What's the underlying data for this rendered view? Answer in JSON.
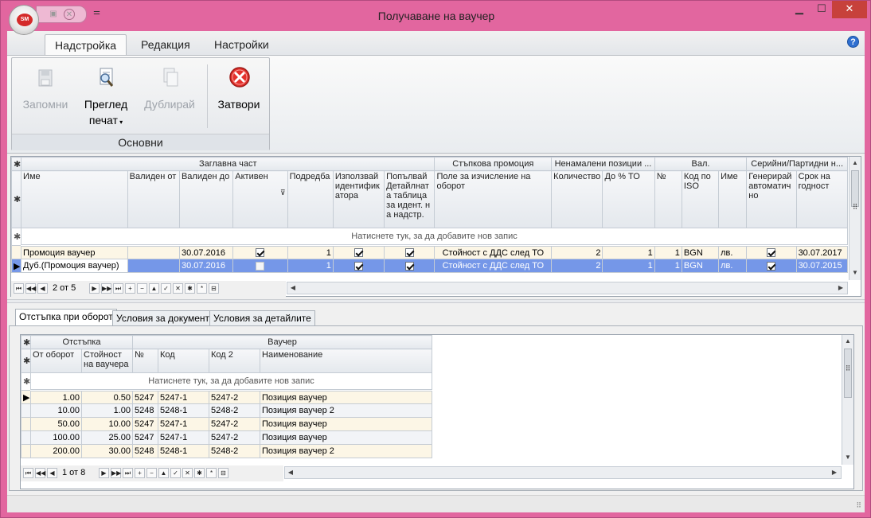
{
  "window": {
    "title": "Получаване на ваучер",
    "orb_text": "SM",
    "min": "▁",
    "max": "☐",
    "close": "✕",
    "help": "?"
  },
  "ribbon": {
    "tabs": [
      "Надстройка",
      "Редакция",
      "Настройки"
    ],
    "group_label": "Основни",
    "buttons": {
      "save": "Запомни",
      "preview_l1": "Преглед",
      "preview_l2": "печат",
      "duplicate": "Дублирай",
      "close": "Затвори"
    }
  },
  "grid1": {
    "bands": {
      "header": "Заглавна част",
      "step": "Стъпкова промоция",
      "nondisc": "Ненамалени позиции ...",
      "currency": "Вал.",
      "serial": "Серийни/Партидни н..."
    },
    "columns": [
      "Име",
      "Валиден от",
      "Валиден до",
      "Активен",
      "Подредба",
      "Използвай идентификатора",
      "Попълвай Детайлната таблица за идент. на надстр.",
      "Поле за изчисление на оборот",
      "Количество",
      "До % ТО",
      "№",
      "Код по ISO",
      "Име",
      "Генерирай автоматично",
      "Срок на годност"
    ],
    "new_row": "Натиснете тук, за да добавите нов запис",
    "rows": [
      {
        "name": "Промоция ваучер",
        "from": "",
        "to": "30.07.2016",
        "active": true,
        "order": "1",
        "use_id": true,
        "fill": true,
        "field": "Стойност с ДДС след ТО",
        "qty": "2",
        "pct": "1",
        "no": "1",
        "iso": "BGN",
        "cname": "лв.",
        "gen": true,
        "expiry": "30.07.2017"
      },
      {
        "name": "Дуб.(Промоция ваучер)",
        "from": "",
        "to": "30.07.2016",
        "active": false,
        "order": "1",
        "use_id": true,
        "fill": true,
        "field": "Стойност с ДДС след ТО",
        "qty": "2",
        "pct": "1",
        "no": "1",
        "iso": "BGN",
        "cname": "лв.",
        "gen": true,
        "expiry": "30.07.2015"
      }
    ],
    "nav": {
      "position": "2 от 5"
    }
  },
  "detail_tabs": [
    "Отстъпка при оборот",
    "Условия за документа",
    "Условия за детайлите"
  ],
  "grid2": {
    "bands": {
      "discount": "Отстъпка",
      "voucher": "Ваучер"
    },
    "columns": [
      "От оборот",
      "Стойност на ваучера",
      "№",
      "Код",
      "Код 2",
      "Наименование"
    ],
    "new_row": "Натиснете тук, за да добавите нов запис",
    "rows": [
      {
        "from": "1.00",
        "value": "0.50",
        "no": "5247",
        "code": "5247-1",
        "code2": "5247-2",
        "name": "Позиция ваучер"
      },
      {
        "from": "10.00",
        "value": "1.00",
        "no": "5248",
        "code": "5248-1",
        "code2": "5248-2",
        "name": "Позиция ваучер 2"
      },
      {
        "from": "50.00",
        "value": "10.00",
        "no": "5247",
        "code": "5247-1",
        "code2": "5247-2",
        "name": "Позиция ваучер"
      },
      {
        "from": "100.00",
        "value": "25.00",
        "no": "5247",
        "code": "5247-1",
        "code2": "5247-2",
        "name": "Позиция ваучер"
      },
      {
        "from": "200.00",
        "value": "30.00",
        "no": "5248",
        "code": "5248-1",
        "code2": "5248-2",
        "name": "Позиция ваучер 2"
      }
    ],
    "nav": {
      "position": "1 от 8"
    }
  },
  "nav_icons": [
    "⏮",
    "◀◀",
    "◀",
    "▶",
    "▶▶",
    "⏭",
    "+",
    "−",
    "▲",
    "✓",
    "✕",
    "✱",
    "*",
    "⊟"
  ],
  "colors": {
    "window_border": "#e2669f",
    "selected_row": "#7597e8",
    "close_button": "#c7413b",
    "odd_row": "#fcf6e6"
  }
}
